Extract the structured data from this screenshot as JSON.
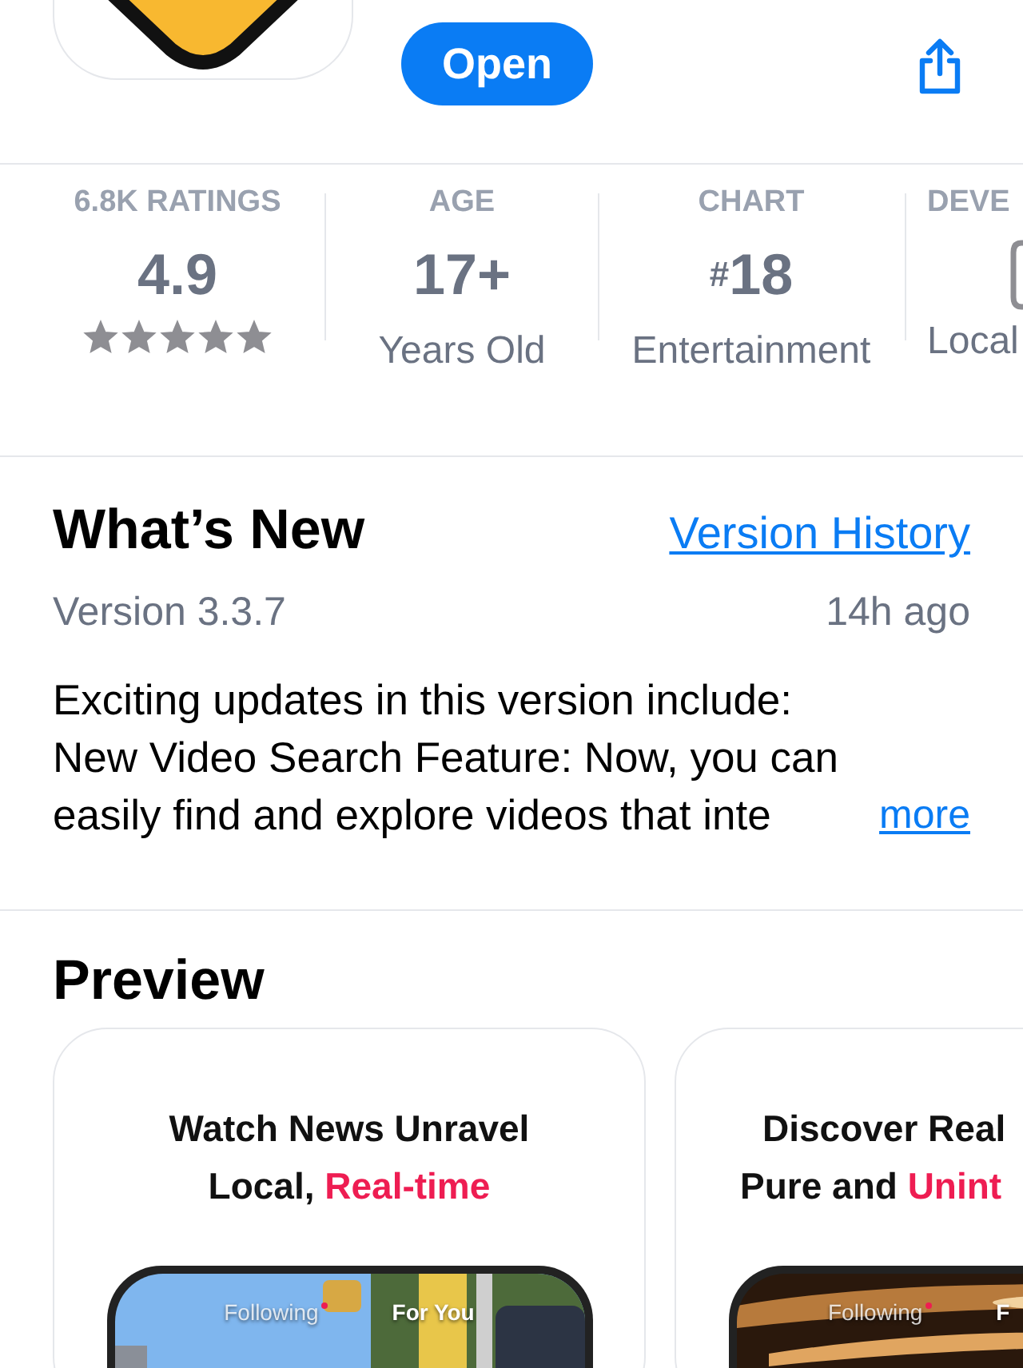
{
  "header": {
    "open_button": "Open"
  },
  "stats": [
    {
      "kind": "rating",
      "label": "6.8K RATINGS",
      "value": "4.9",
      "stars": 5
    },
    {
      "kind": "text",
      "label": "AGE",
      "value": "17+",
      "sub": "Years Old"
    },
    {
      "kind": "chart",
      "label": "CHART",
      "prefix": "#",
      "value": "18",
      "sub": "Entertainment"
    },
    {
      "kind": "device",
      "label": "DEVE",
      "sub": "Local"
    }
  ],
  "whats_new": {
    "title": "What’s New",
    "link": "Version History",
    "version": "Version 3.3.7",
    "age": "14h ago",
    "lines": [
      "Exciting updates in this version include:",
      "New Video Search Feature: Now, you can",
      "easily find and explore videos that inte"
    ],
    "more": "more"
  },
  "preview": {
    "title": "Preview",
    "cards": [
      {
        "lines": [
          [
            {
              "text": "Watch News Unravel",
              "highlight": false
            }
          ],
          [
            {
              "text": "Local, ",
              "highlight": false
            },
            {
              "text": "Real-time",
              "highlight": true
            }
          ]
        ],
        "tabs": [
          "Following",
          "For You"
        ]
      },
      {
        "lines": [
          [
            {
              "text": "Discover Real",
              "highlight": false
            }
          ],
          [
            {
              "text": "Pure and ",
              "highlight": false
            },
            {
              "text": "Unint",
              "highlight": true
            }
          ]
        ],
        "tabs": [
          "Following",
          "F"
        ]
      }
    ]
  }
}
